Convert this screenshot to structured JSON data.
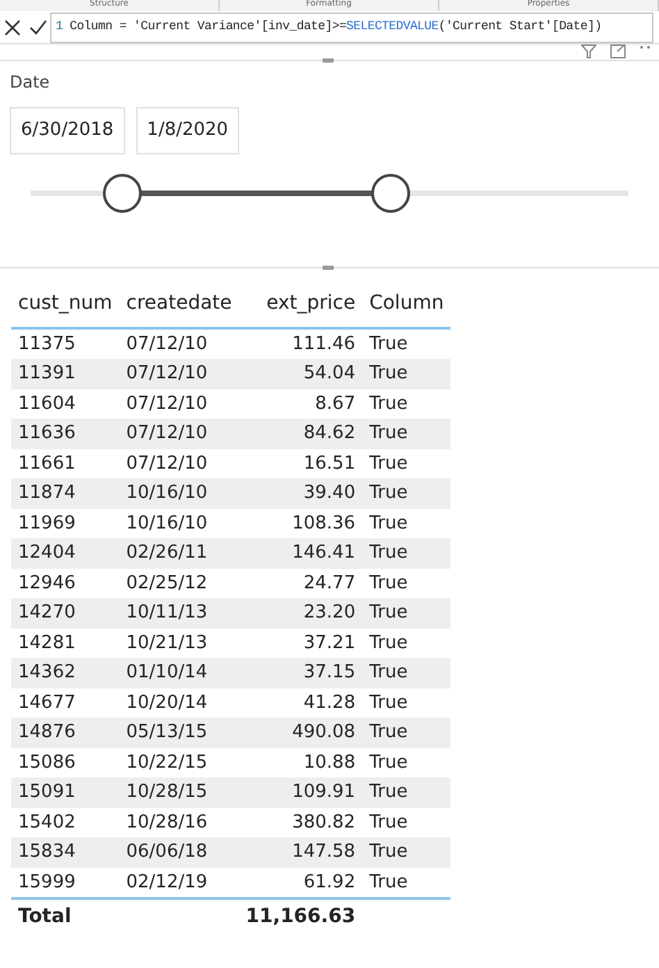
{
  "pane_tabs": [
    "Structure",
    "Formatting",
    "Properties"
  ],
  "formula_bar": {
    "line_number": "1",
    "parts": [
      {
        "kind": "plain",
        "text": "Column = 'Current Variance'[inv_date]>="
      },
      {
        "kind": "function",
        "text": "SELECTEDVALUE"
      },
      {
        "kind": "plain",
        "text": "('Current Start'[Date])"
      }
    ]
  },
  "slicer": {
    "title": "Date",
    "start": "6/30/2018",
    "end": "1/8/2020",
    "range_start": {
      "level": 0.153
    },
    "range_end": {
      "level": 0.603
    }
  },
  "table": {
    "columns": [
      "cust_num",
      "createdate",
      "ext_price",
      "Column"
    ],
    "rows": [
      [
        "11375",
        "07/12/10",
        "111.46",
        "True"
      ],
      [
        "11391",
        "07/12/10",
        "54.04",
        "True"
      ],
      [
        "11604",
        "07/12/10",
        "8.67",
        "True"
      ],
      [
        "11636",
        "07/12/10",
        "84.62",
        "True"
      ],
      [
        "11661",
        "07/12/10",
        "16.51",
        "True"
      ],
      [
        "11874",
        "10/16/10",
        "39.40",
        "True"
      ],
      [
        "11969",
        "10/16/10",
        "108.36",
        "True"
      ],
      [
        "12404",
        "02/26/11",
        "146.41",
        "True"
      ],
      [
        "12946",
        "02/25/12",
        "24.77",
        "True"
      ],
      [
        "14270",
        "10/11/13",
        "23.20",
        "True"
      ],
      [
        "14281",
        "10/21/13",
        "37.21",
        "True"
      ],
      [
        "14362",
        "01/10/14",
        "37.15",
        "True"
      ],
      [
        "14677",
        "10/20/14",
        "41.28",
        "True"
      ],
      [
        "14876",
        "05/13/15",
        "490.08",
        "True"
      ],
      [
        "15086",
        "10/22/15",
        "10.88",
        "True"
      ],
      [
        "15091",
        "10/28/15",
        "109.91",
        "True"
      ],
      [
        "15402",
        "10/28/16",
        "380.82",
        "True"
      ],
      [
        "15834",
        "06/06/18",
        "147.58",
        "True"
      ],
      [
        "15999",
        "02/12/19",
        "61.92",
        "True"
      ]
    ],
    "total": {
      "label": "Total",
      "ext_price": "11,166.63"
    }
  }
}
